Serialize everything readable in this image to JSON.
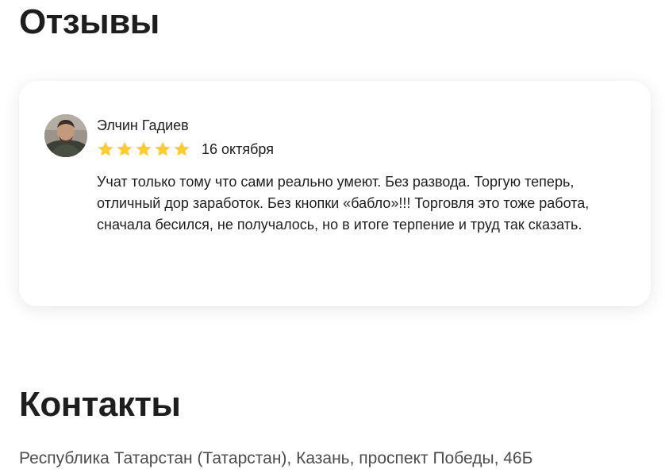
{
  "reviews_section": {
    "title": "Отзывы"
  },
  "review": {
    "author": "Элчин Гадиев",
    "rating": 5,
    "rating_max": 5,
    "date": "16 октября",
    "text": "Учат только тому что сами реально умеют. Без развода. Торгую теперь, отличный дор заработок. Без кнопки «бабло»!!! Торговля это тоже работа, сначала бесился, не получалось, но в итоге терпение и труд так сказать.",
    "star_color": "#ffcc33"
  },
  "contacts_section": {
    "title": "Контакты",
    "address": "Республика Татарстан (Татарстан), Казань, проспект Победы, 46Б"
  }
}
